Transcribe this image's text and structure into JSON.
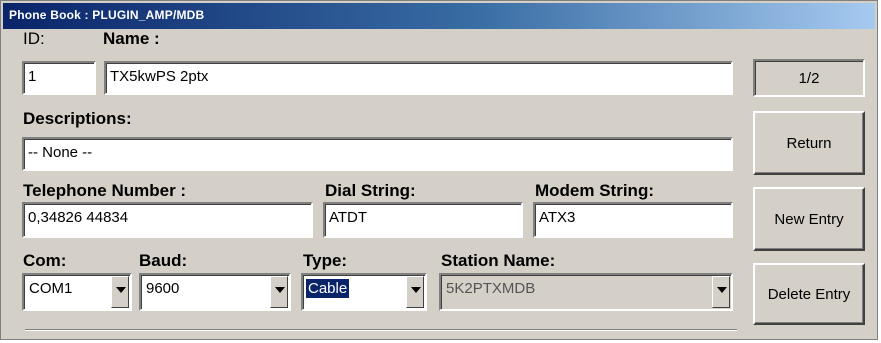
{
  "window": {
    "title": "Phone Book : PLUGIN_AMP/MDB"
  },
  "labels": {
    "id": "ID:",
    "name": "Name :",
    "descriptions": "Descriptions:",
    "telephone": "Telephone Number :",
    "dial": "Dial String:",
    "modem": "Modem String:",
    "com": "Com:",
    "baud": "Baud:",
    "type": "Type:",
    "station": "Station Name:"
  },
  "fields": {
    "id": "1",
    "name": "TX5kwPS 2ptx",
    "descriptions": "-- None --",
    "telephone": "0,34826 44834",
    "dial": "ATDT",
    "modem": "ATX3"
  },
  "combos": {
    "com": "COM1",
    "baud": "9600",
    "type": "Cable",
    "station": "5K2PTXMDB"
  },
  "side": {
    "counter": "1/2",
    "return_label": "Return",
    "new_label": "New Entry",
    "delete_label": "Delete Entry"
  },
  "icons": {
    "dropdown": "chevron-down-icon"
  }
}
